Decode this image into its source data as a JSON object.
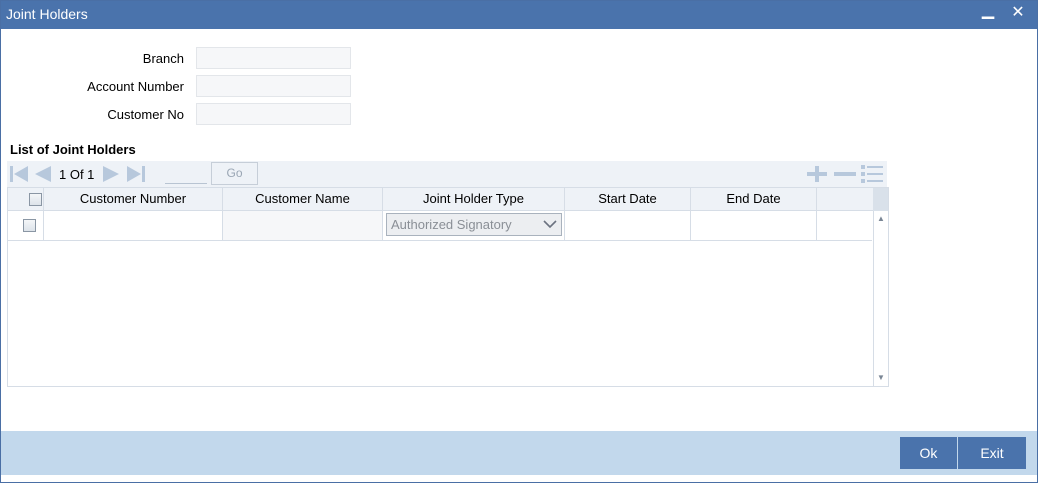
{
  "window": {
    "title": "Joint Holders",
    "minimize_glyph": "▁",
    "close_glyph": "✕"
  },
  "form": {
    "branch_label": "Branch",
    "account_number_label": "Account Number",
    "customer_no_label": "Customer No",
    "branch_value": "",
    "account_number_value": "",
    "customer_no_value": ""
  },
  "list": {
    "title": "List of Joint Holders",
    "pagination": {
      "text": "1 Of 1",
      "go_label": "Go",
      "page_input": ""
    },
    "columns": [
      "Customer Number",
      "Customer Name",
      "Joint Holder Type",
      "Start Date",
      "End Date"
    ],
    "rows": [
      {
        "customer_number": "",
        "customer_name": "",
        "joint_holder_type": "Authorized Signatory",
        "start_date": "",
        "end_date": ""
      }
    ],
    "icons": [
      "first-page-icon",
      "previous-page-icon",
      "next-page-icon",
      "last-page-icon",
      "add-row-icon",
      "delete-row-icon",
      "single-view-icon"
    ]
  },
  "footer": {
    "ok_label": "Ok",
    "exit_label": "Exit"
  },
  "colors": {
    "titlebar": "#4a73ac",
    "footer": "#c2d8ec",
    "nav_icon": "#b7c8dc",
    "button": "#4a73ac"
  }
}
